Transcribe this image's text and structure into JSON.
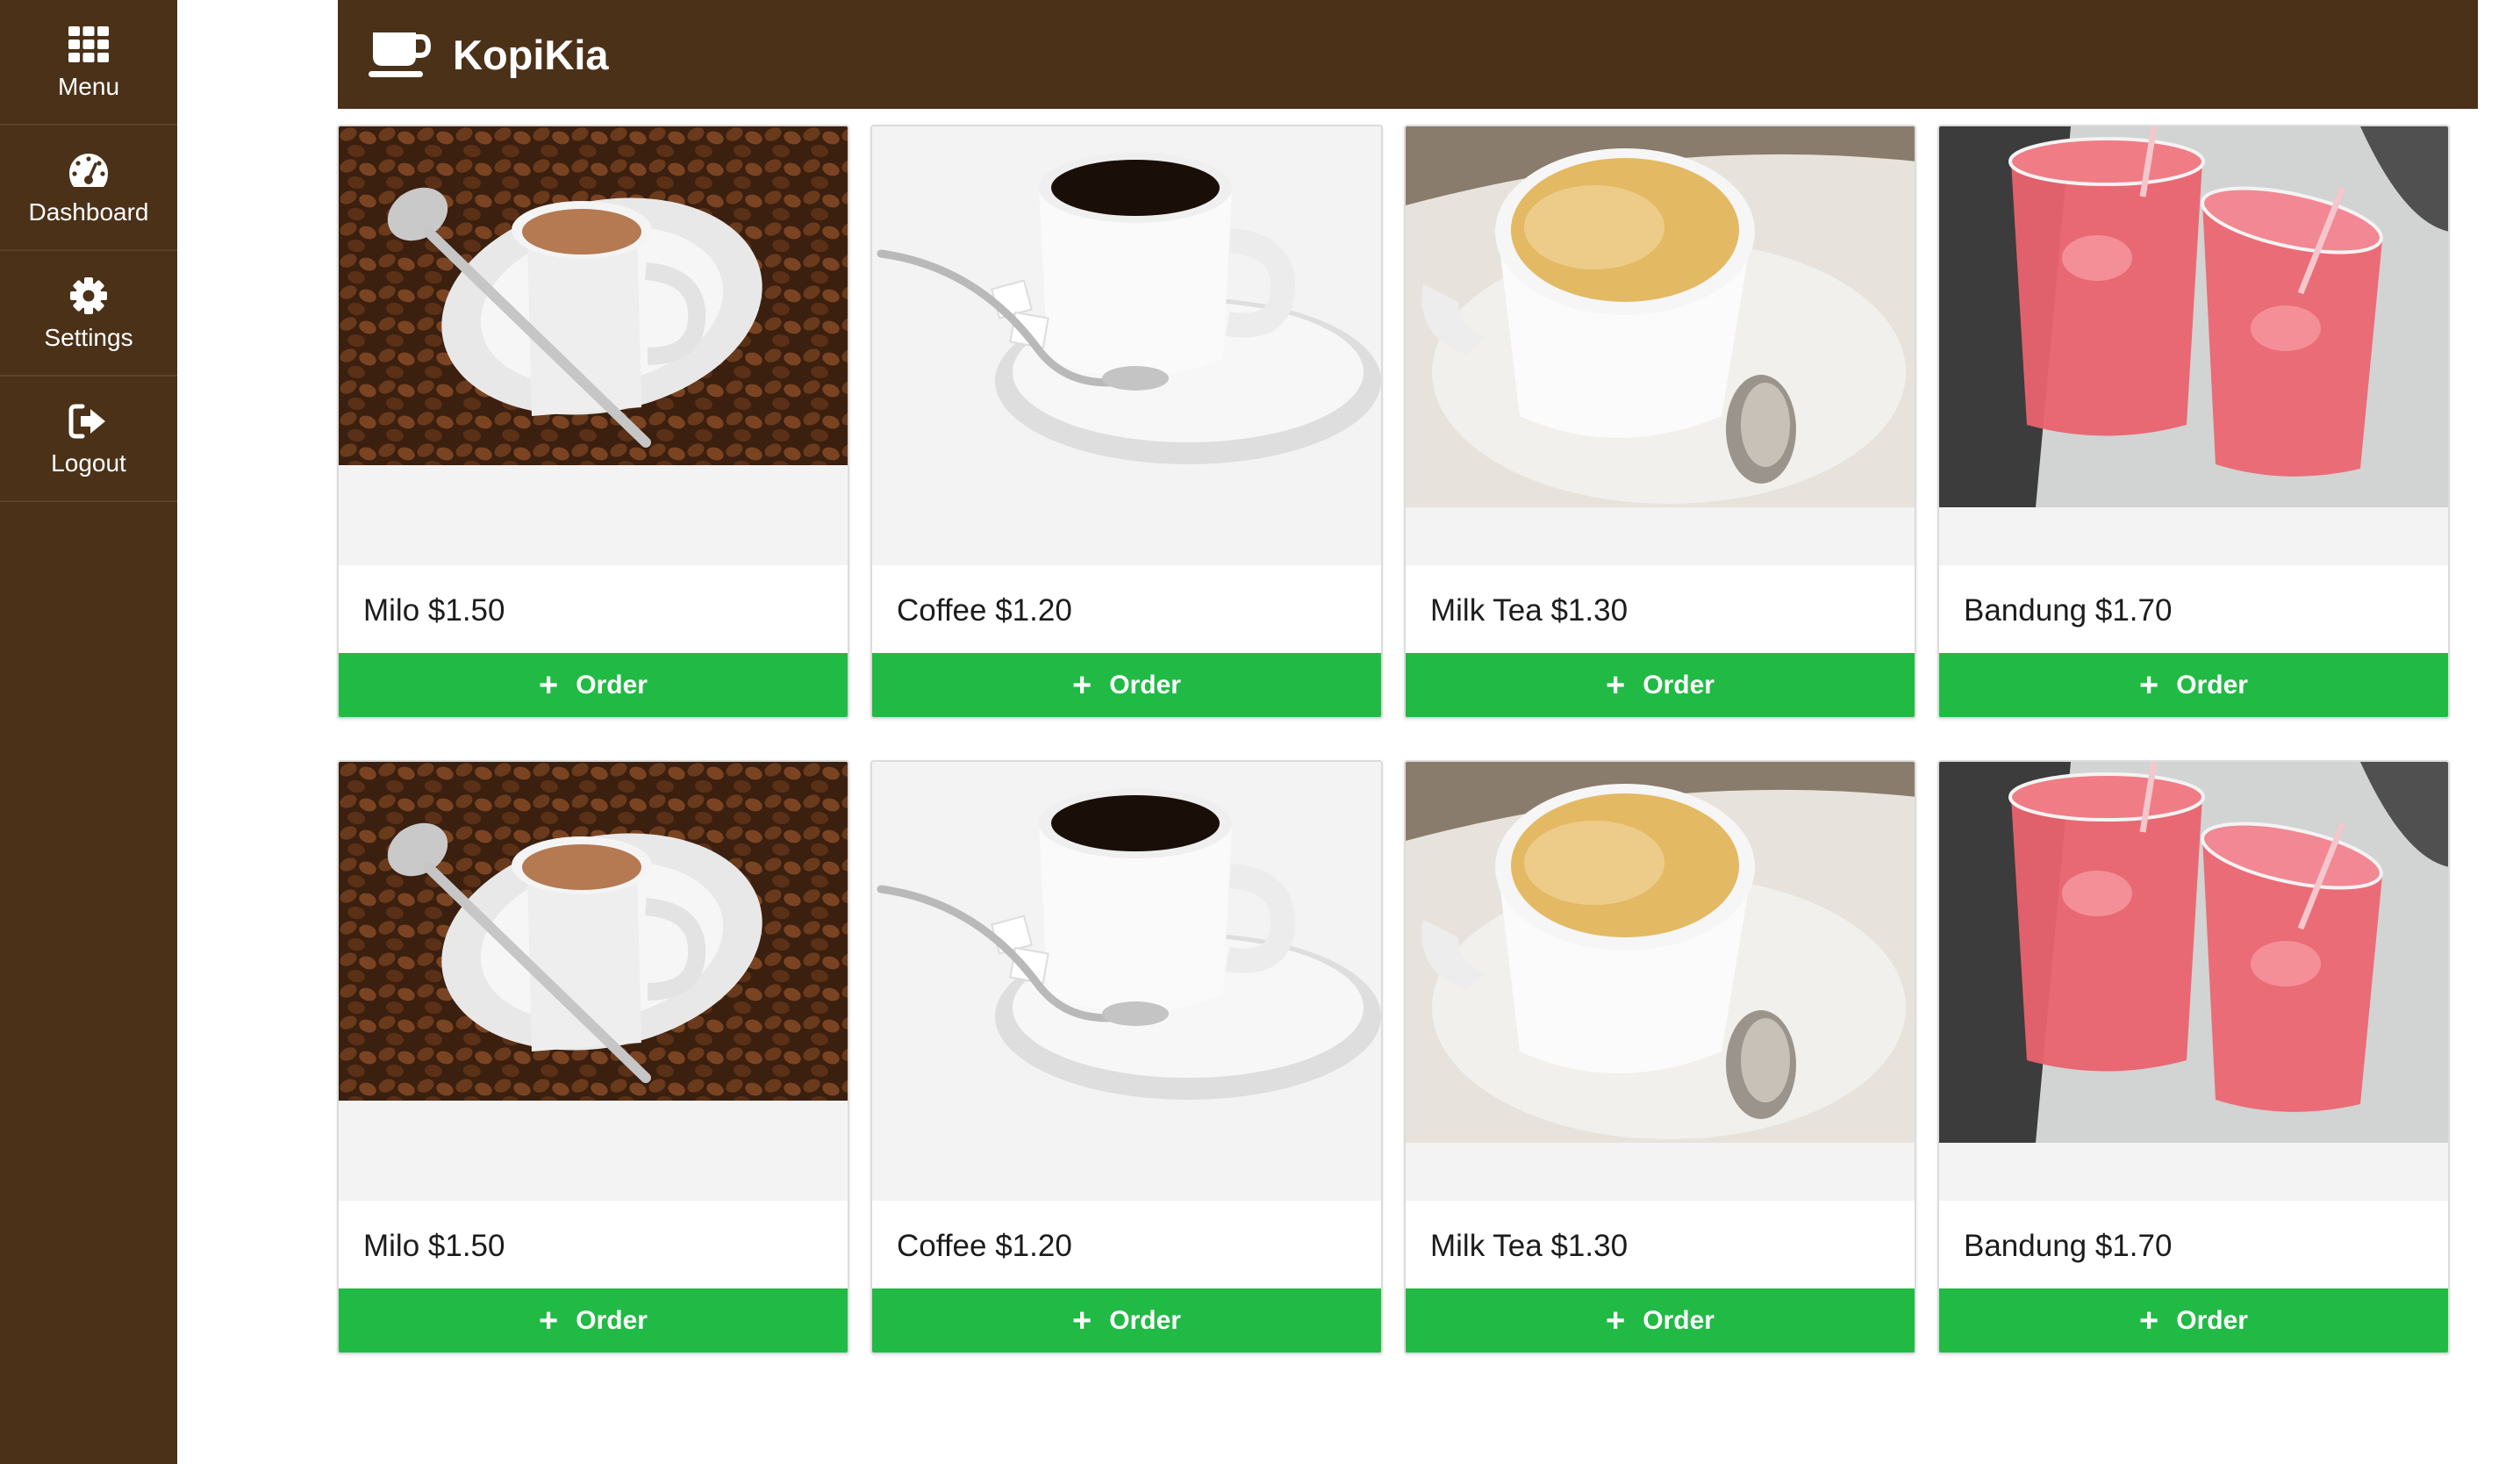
{
  "app": {
    "title": "KopiKia",
    "brand_color": "#4b3118",
    "accent_color": "#21ba45"
  },
  "sidebar": {
    "items": [
      {
        "label": "Menu",
        "icon": "grid-icon"
      },
      {
        "label": "Dashboard",
        "icon": "dashboard-icon"
      },
      {
        "label": "Settings",
        "icon": "gear-icon"
      },
      {
        "label": "Logout",
        "icon": "sign-out-icon"
      }
    ]
  },
  "products": [
    {
      "name": "Milo $1.50",
      "order_label": "Order",
      "image": "milo-image"
    },
    {
      "name": "Coffee $1.20",
      "order_label": "Order",
      "image": "coffee-image"
    },
    {
      "name": "Milk Tea $1.30",
      "order_label": "Order",
      "image": "milk-tea-image"
    },
    {
      "name": "Bandung $1.70",
      "order_label": "Order",
      "image": "bandung-image"
    },
    {
      "name": "Milo $1.50",
      "order_label": "Order",
      "image": "milo-image"
    },
    {
      "name": "Coffee $1.20",
      "order_label": "Order",
      "image": "coffee-image"
    },
    {
      "name": "Milk Tea $1.30",
      "order_label": "Order",
      "image": "milk-tea-image"
    },
    {
      "name": "Bandung $1.70",
      "order_label": "Order",
      "image": "bandung-image"
    }
  ]
}
